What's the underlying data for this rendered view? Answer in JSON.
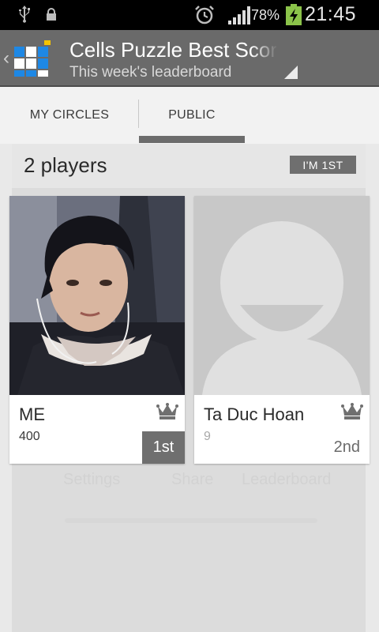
{
  "status_bar": {
    "battery_percent": "78%",
    "time": "21:45"
  },
  "action_bar": {
    "title": "Cells Puzzle Best Score",
    "subtitle": "This week's leaderboard",
    "up_caret": "‹"
  },
  "tabs": [
    {
      "label": "MY CIRCLES",
      "selected": false
    },
    {
      "label": "PUBLIC",
      "selected": true
    }
  ],
  "leaderboard": {
    "player_count": "2 players",
    "im_first_label": "I'M 1ST",
    "players": [
      {
        "name": "ME",
        "score": "400",
        "rank": "1st"
      },
      {
        "name": "Ta Duc Hoan",
        "score": "9",
        "rank": "2nd"
      }
    ]
  },
  "background_ghost": {
    "settings": "Settings",
    "share": "Share",
    "leaderboard": "Leaderboard"
  },
  "colors": {
    "action_bar": "#6a6a6a",
    "tab_indicator": "#6c6c6c",
    "app_icon_blue": "#1e88e5",
    "charging_green": "#8bc34a"
  }
}
